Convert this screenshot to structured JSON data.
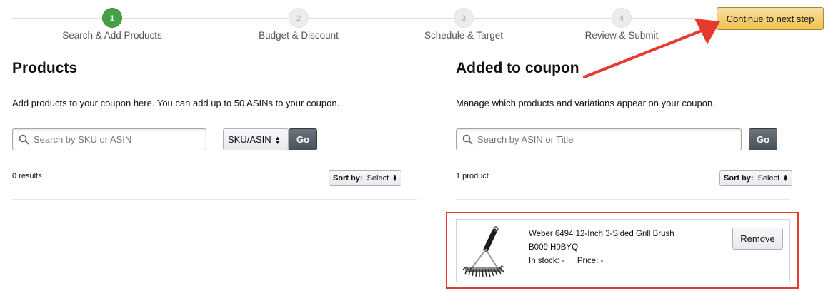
{
  "stepper": {
    "steps": [
      {
        "number": "1",
        "label": "Search & Add Products"
      },
      {
        "number": "2",
        "label": "Budget & Discount"
      },
      {
        "number": "3",
        "label": "Schedule & Target"
      },
      {
        "number": "4",
        "label": "Review & Submit"
      }
    ],
    "active_step": 1,
    "continue_label": "Continue to next step"
  },
  "products_panel": {
    "title": "Products",
    "description": "Add products to your coupon here. You can add up to 50 ASINs to your coupon.",
    "search_placeholder": "Search by SKU or ASIN",
    "search_value": "",
    "search_type": "SKU/ASIN",
    "go_label": "Go",
    "result_count": "0 results",
    "sort_label": "Sort by:",
    "sort_value": "Select"
  },
  "coupon_panel": {
    "title": "Added to coupon",
    "description": "Manage which products and variations appear on your coupon.",
    "search_placeholder": "Search by ASIN or Title",
    "search_value": "",
    "go_label": "Go",
    "result_count": "1 product",
    "sort_label": "Sort by:",
    "sort_value": "Select",
    "products": [
      {
        "title": "Weber 6494 12-Inch 3-Sided Grill Brush",
        "asin": "B009IH0BYQ",
        "stock_label": "In stock:",
        "stock_value": "-",
        "price_label": "Price:",
        "price_value": "-",
        "remove_label": "Remove",
        "image_icon": "grill-brush-image"
      }
    ]
  },
  "colors": {
    "accent_green": "#43a047",
    "continue_button": "#f0c14b",
    "annotation_red": "#e53a2d"
  }
}
